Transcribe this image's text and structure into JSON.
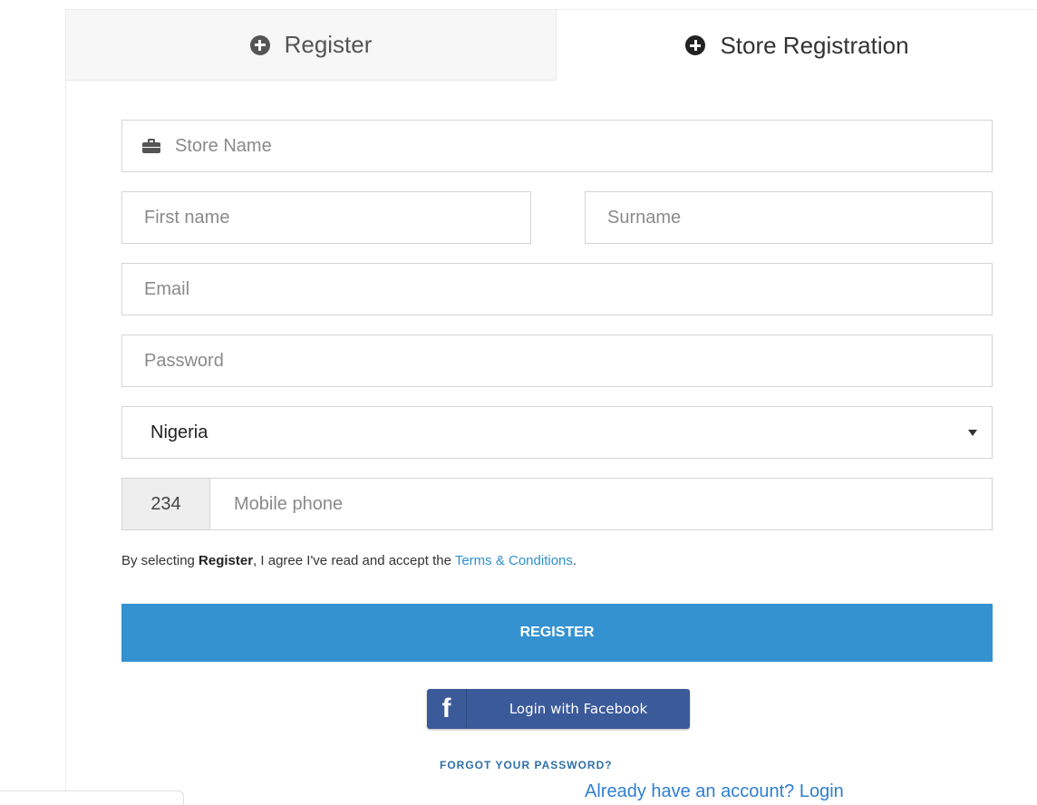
{
  "tabs": {
    "register": "Register",
    "store_registration": "Store Registration"
  },
  "form": {
    "store_name_placeholder": "Store Name",
    "first_name_placeholder": "First name",
    "surname_placeholder": "Surname",
    "email_placeholder": "Email",
    "password_placeholder": "Password",
    "country_value": "Nigeria",
    "phone_code": "234",
    "mobile_placeholder": "Mobile phone"
  },
  "terms": {
    "prefix": "By selecting ",
    "bold": "Register",
    "middle": ", I agree I've read and accept the ",
    "link": "Terms & Conditions",
    "suffix": "."
  },
  "buttons": {
    "register": "REGISTER",
    "facebook_letter": "f",
    "facebook": "Login with Facebook",
    "forgot": "FORGOT YOUR PASSWORD?",
    "already": "Already have an account? Login"
  },
  "icons": {
    "tab_icon": "plus-circle-icon",
    "store_icon": "briefcase-icon",
    "select_icon": "caret-down-icon",
    "facebook_icon": "facebook-icon"
  },
  "colors": {
    "primary": "#3592d1",
    "facebook": "#3b5a9a",
    "link": "#2f8fcf"
  }
}
